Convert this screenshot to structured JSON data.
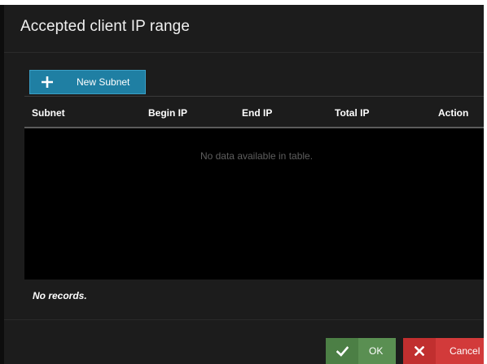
{
  "dialog": {
    "title": "Accepted client IP range"
  },
  "toolbar": {
    "new_subnet_label": "New Subnet",
    "new_subnet_icon": "plus-icon"
  },
  "table": {
    "columns": [
      "Subnet",
      "Begin IP",
      "End IP",
      "Total IP",
      "Action"
    ],
    "rows": [],
    "empty_message": "No data available in table."
  },
  "footer": {
    "records_text": "No records.",
    "ok_label": "OK",
    "ok_icon": "check-icon",
    "cancel_label": "Cancel",
    "cancel_icon": "close-icon"
  },
  "colors": {
    "primary_button": "#1f7fa3",
    "ok_button": "#5a8f52",
    "cancel_button": "#d23a3a",
    "dialog_background": "#1c1c1c",
    "table_body": "#000000"
  }
}
